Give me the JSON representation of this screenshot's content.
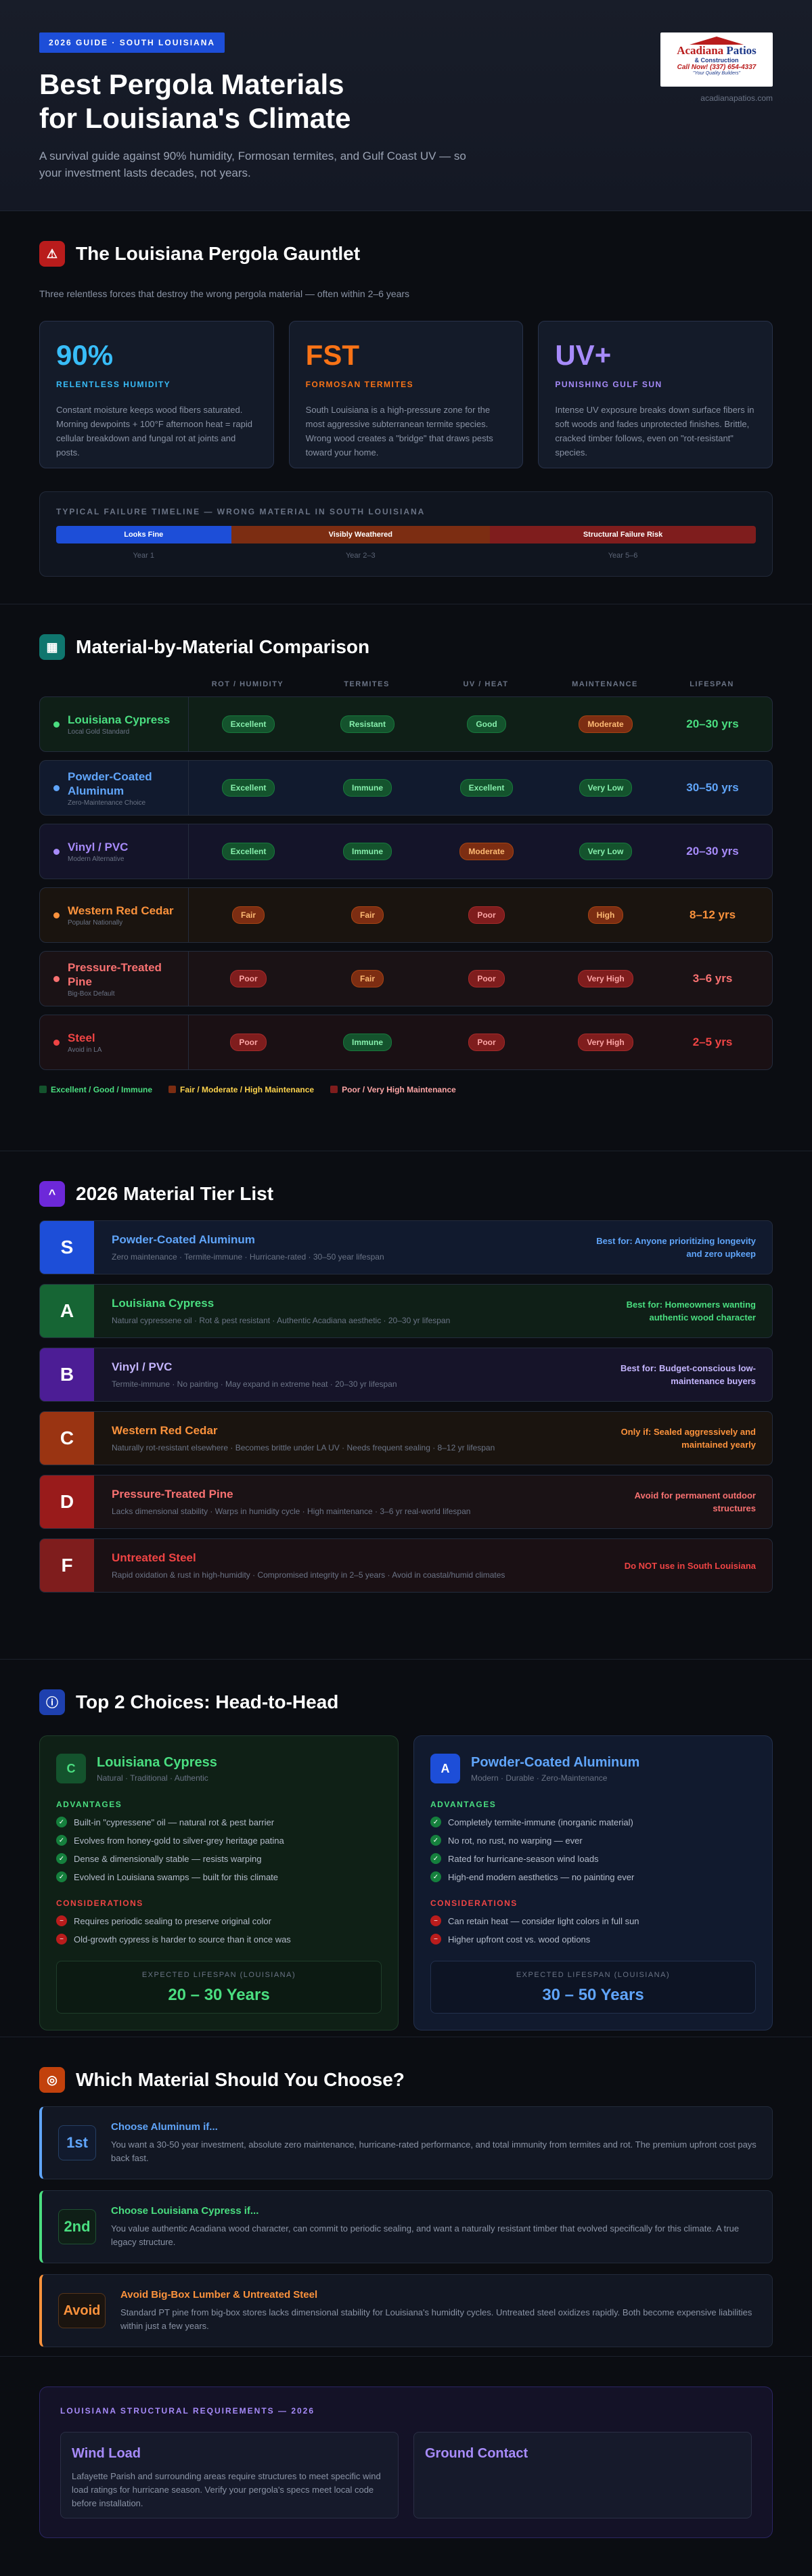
{
  "hero": {
    "tag": "2026 GUIDE · SOUTH LOUISIANA",
    "title_l1": "Best Pergola Materials",
    "title_l2": "for Louisiana's Climate",
    "intro": "A survival guide against 90% humidity, Formosan termites, and Gulf Coast UV — so your investment lasts decades, not years.",
    "logo": {
      "brand_a": "Acadiana",
      "brand_b": "Patios",
      "line2": "& Construction",
      "phone": "Call Now! (337) 654-4337",
      "tagline": "\"Your Quality Builders\""
    },
    "site": "acadianapatios.com"
  },
  "gauntlet": {
    "title": "The Louisiana Pergola Gauntlet",
    "icon": "warning-icon",
    "subtitle": "Three relentless forces that destroy the wrong pergola material — often within 2–6 years",
    "stats": [
      {
        "value": "90%",
        "label": "RELENTLESS HUMIDITY",
        "text": "Constant moisture keeps wood fibers saturated. Morning dewpoints + 100°F afternoon heat = rapid cellular breakdown and fungal rot at joints and posts.",
        "color": "#38bdf8"
      },
      {
        "value": "FST",
        "label": "FORMOSAN TERMITES",
        "text": "South Louisiana is a high-pressure zone for the most aggressive subterranean termite species. Wrong wood creates a \"bridge\" that draws pests toward your home.",
        "color": "#f97316"
      },
      {
        "value": "UV+",
        "label": "PUNISHING GULF SUN",
        "text": "Intense UV exposure breaks down surface fibers in soft woods and fades unprotected finishes. Brittle, cracked timber follows, even on \"rot-resistant\" species.",
        "color": "#a78bfa"
      }
    ],
    "timeline": {
      "title": "TYPICAL FAILURE TIMELINE — WRONG MATERIAL IN SOUTH LOUISIANA",
      "segments": [
        {
          "label": "Looks Fine",
          "year": "Year 1",
          "share": 0.25,
          "color": "#1d4ed8"
        },
        {
          "label": "Visibly Weathered",
          "year": "Year 2–3",
          "share": 0.37,
          "color": "#7c2d12"
        },
        {
          "label": "Structural Failure Risk",
          "year": "Year 5–6",
          "share": 0.38,
          "color": "#7f1d1d"
        }
      ]
    }
  },
  "comparison": {
    "title": "Material-by-Material Comparison",
    "icon": "table-icon",
    "headers": [
      "ROT / HUMIDITY",
      "TERMITES",
      "UV / HEAT",
      "MAINTENANCE",
      "LIFESPAN"
    ],
    "rows": [
      {
        "name": "Louisiana Cypress",
        "sub": "Local Gold Standard",
        "color": "#4ade80",
        "bg": "#0f1f17",
        "cells": [
          [
            "Excellent",
            "g"
          ],
          [
            "Resistant",
            "g"
          ],
          [
            "Good",
            "g"
          ],
          [
            "Moderate",
            "o"
          ]
        ],
        "life": "20–30 yrs"
      },
      {
        "name": "Powder-Coated Aluminum",
        "sub": "Zero-Maintenance Choice",
        "color": "#60a5fa",
        "bg": "#111a2e",
        "cells": [
          [
            "Excellent",
            "g"
          ],
          [
            "Immune",
            "g"
          ],
          [
            "Excellent",
            "g"
          ],
          [
            "Very Low",
            "g"
          ]
        ],
        "life": "30–50 yrs"
      },
      {
        "name": "Vinyl / PVC",
        "sub": "Modern Alternative",
        "color": "#a78bfa",
        "bg": "#141429",
        "cells": [
          [
            "Excellent",
            "g"
          ],
          [
            "Immune",
            "g"
          ],
          [
            "Moderate",
            "o"
          ],
          [
            "Very Low",
            "g"
          ]
        ],
        "life": "20–30 yrs"
      },
      {
        "name": "Western Red Cedar",
        "sub": "Popular Nationally",
        "color": "#fb923c",
        "bg": "#1a140f",
        "cells": [
          [
            "Fair",
            "o"
          ],
          [
            "Fair",
            "o"
          ],
          [
            "Poor",
            "r"
          ],
          [
            "High",
            "o"
          ]
        ],
        "life": "8–12 yrs"
      },
      {
        "name": "Pressure-Treated Pine",
        "sub": "Big-Box Default",
        "color": "#f87171",
        "bg": "#1a1215",
        "cells": [
          [
            "Poor",
            "r"
          ],
          [
            "Fair",
            "o"
          ],
          [
            "Poor",
            "r"
          ],
          [
            "Very High",
            "r"
          ]
        ],
        "life": "3–6 yrs"
      },
      {
        "name": "Steel",
        "sub": "Avoid in LA",
        "color": "#ef4444",
        "bg": "#1a1014",
        "cells": [
          [
            "Poor",
            "r"
          ],
          [
            "Immune",
            "g"
          ],
          [
            "Poor",
            "r"
          ],
          [
            "Very High",
            "r"
          ]
        ],
        "life": "2–5 yrs"
      }
    ],
    "legend": [
      {
        "label": "Excellent / Good / Immune",
        "color": "#4ade80",
        "sw": "#14532d"
      },
      {
        "label": "Fair / Moderate / High Maintenance",
        "color": "#fcd34d",
        "sw": "#7c2d12"
      },
      {
        "label": "Poor / Very High Maintenance",
        "color": "#fca5a5",
        "sw": "#7f1d1d"
      }
    ]
  },
  "tiers": {
    "title": "2026 Material Tier List",
    "icon": "chevron-up-icon",
    "items": [
      {
        "tier": "S",
        "name": "Powder-Coated Aluminum",
        "desc": "Zero maintenance · Termite-immune · Hurricane-rated · 30–50 year lifespan",
        "note": "Best for: Anyone prioritizing longevity and zero upkeep",
        "badge": "#1d4ed8",
        "color": "#60a5fa",
        "bg": "#111a2e"
      },
      {
        "tier": "A",
        "name": "Louisiana Cypress",
        "desc": "Natural cypressene oil · Rot & pest resistant · Authentic Acadiana aesthetic · 20–30 yr lifespan",
        "note": "Best for: Homeowners wanting authentic wood character",
        "badge": "#166534",
        "color": "#4ade80",
        "bg": "#0f1f17"
      },
      {
        "tier": "B",
        "name": "Vinyl / PVC",
        "desc": "Termite-immune · No painting · May expand in extreme heat · 20–30 yr lifespan",
        "note": "Best for: Budget-conscious low-maintenance buyers",
        "badge": "#4c1d95",
        "color": "#c4b5fd",
        "bg": "#161429"
      },
      {
        "tier": "C",
        "name": "Western Red Cedar",
        "desc": "Naturally rot-resistant elsewhere · Becomes brittle under LA UV · Needs frequent sealing · 8–12 yr lifespan",
        "note": "Only if: Sealed aggressively and maintained yearly",
        "badge": "#9a3412",
        "color": "#fb923c",
        "bg": "#1a140f"
      },
      {
        "tier": "D",
        "name": "Pressure-Treated Pine",
        "desc": "Lacks dimensional stability · Warps in humidity cycle · High maintenance · 3–6 yr real-world lifespan",
        "note": "Avoid for permanent outdoor structures",
        "badge": "#991b1b",
        "color": "#f87171",
        "bg": "#1a1215"
      },
      {
        "tier": "F",
        "name": "Untreated Steel",
        "desc": "Rapid oxidation & rust in high-humidity · Compromised integrity in 2–5 years · Avoid in coastal/humid climates",
        "note": "Do NOT use in South Louisiana",
        "badge": "#7f1d1d",
        "color": "#ef4444",
        "bg": "#1a1014"
      }
    ]
  },
  "h2h": {
    "title": "Top 2 Choices: Head-to-Head",
    "icon": "info-icon",
    "cards": [
      {
        "letter": "C",
        "name": "Louisiana Cypress",
        "sub": "Natural · Traditional · Authentic",
        "color": "#4ade80",
        "bg": "#0f2016",
        "border": "#1f3d2a",
        "iconbg": "#14532d",
        "adv_label": "ADVANTAGES",
        "adv": [
          "Built-in \"cypressene\" oil — natural rot & pest barrier",
          "Evolves from honey-gold to silver-grey heritage patina",
          "Dense & dimensionally stable — resists warping",
          "Evolved in Louisiana swamps — built for this climate"
        ],
        "con_label": "CONSIDERATIONS",
        "con": [
          "Requires periodic sealing to preserve original color",
          "Old-growth cypress is harder to source than it once was"
        ],
        "exp_label": "EXPECTED LIFESPAN (LOUISIANA)",
        "exp": "20 – 30 Years",
        "expbg": "#0c1a12"
      },
      {
        "letter": "A",
        "name": "Powder-Coated Aluminum",
        "sub": "Modern · Durable · Zero-Maintenance",
        "color": "#60a5fa",
        "bg": "#111a2e",
        "border": "#22304d",
        "iconbg": "#1d4ed8",
        "adv_label": "ADVANTAGES",
        "adv": [
          "Completely termite-immune (inorganic material)",
          "No rot, no rust, no warping — ever",
          "Rated for hurricane-season wind loads",
          "High-end modern aesthetics — no painting ever"
        ],
        "con_label": "CONSIDERATIONS",
        "con": [
          "Can retain heat — consider light colors in full sun",
          "Higher upfront cost vs. wood options"
        ],
        "exp_label": "EXPECTED LIFESPAN (LOUISIANA)",
        "exp": "30 – 50 Years",
        "expbg": "#0d1424"
      }
    ]
  },
  "choose": {
    "title": "Which Material Should You Choose?",
    "icon": "target-icon",
    "items": [
      {
        "rank": "1st",
        "title": "Choose Aluminum if...",
        "text": "You want a 30-50 year investment, absolute zero maintenance, hurricane-rated performance, and total immunity from termites and rot. The premium upfront cost pays back fast.",
        "color": "#60a5fa",
        "rbg": "#111a2e"
      },
      {
        "rank": "2nd",
        "title": "Choose Louisiana Cypress if...",
        "text": "You value authentic Acadiana wood character, can commit to periodic sealing, and want a naturally resistant timber that evolved specifically for this climate. A true legacy structure.",
        "color": "#4ade80",
        "rbg": "#0f1f17"
      },
      {
        "rank": "Avoid",
        "title": "Avoid Big-Box Lumber & Untreated Steel",
        "text": "Standard PT pine from big-box stores lacks dimensional stability for Louisiana's humidity cycles. Untreated steel oxidizes rapidly. Both become expensive liabilities within just a few years.",
        "color": "#fb923c",
        "rbg": "#1a140f"
      }
    ]
  },
  "requirements": {
    "title": "LOUISIANA STRUCTURAL REQUIREMENTS — 2026",
    "boxes": [
      {
        "title": "Wind Load",
        "text": "Lafayette Parish and surrounding areas require structures to meet specific wind load ratings for hurricane season. Verify your pergola's specs meet local code before installation."
      },
      {
        "title": "Ground Contact",
        "text": ""
      }
    ]
  }
}
